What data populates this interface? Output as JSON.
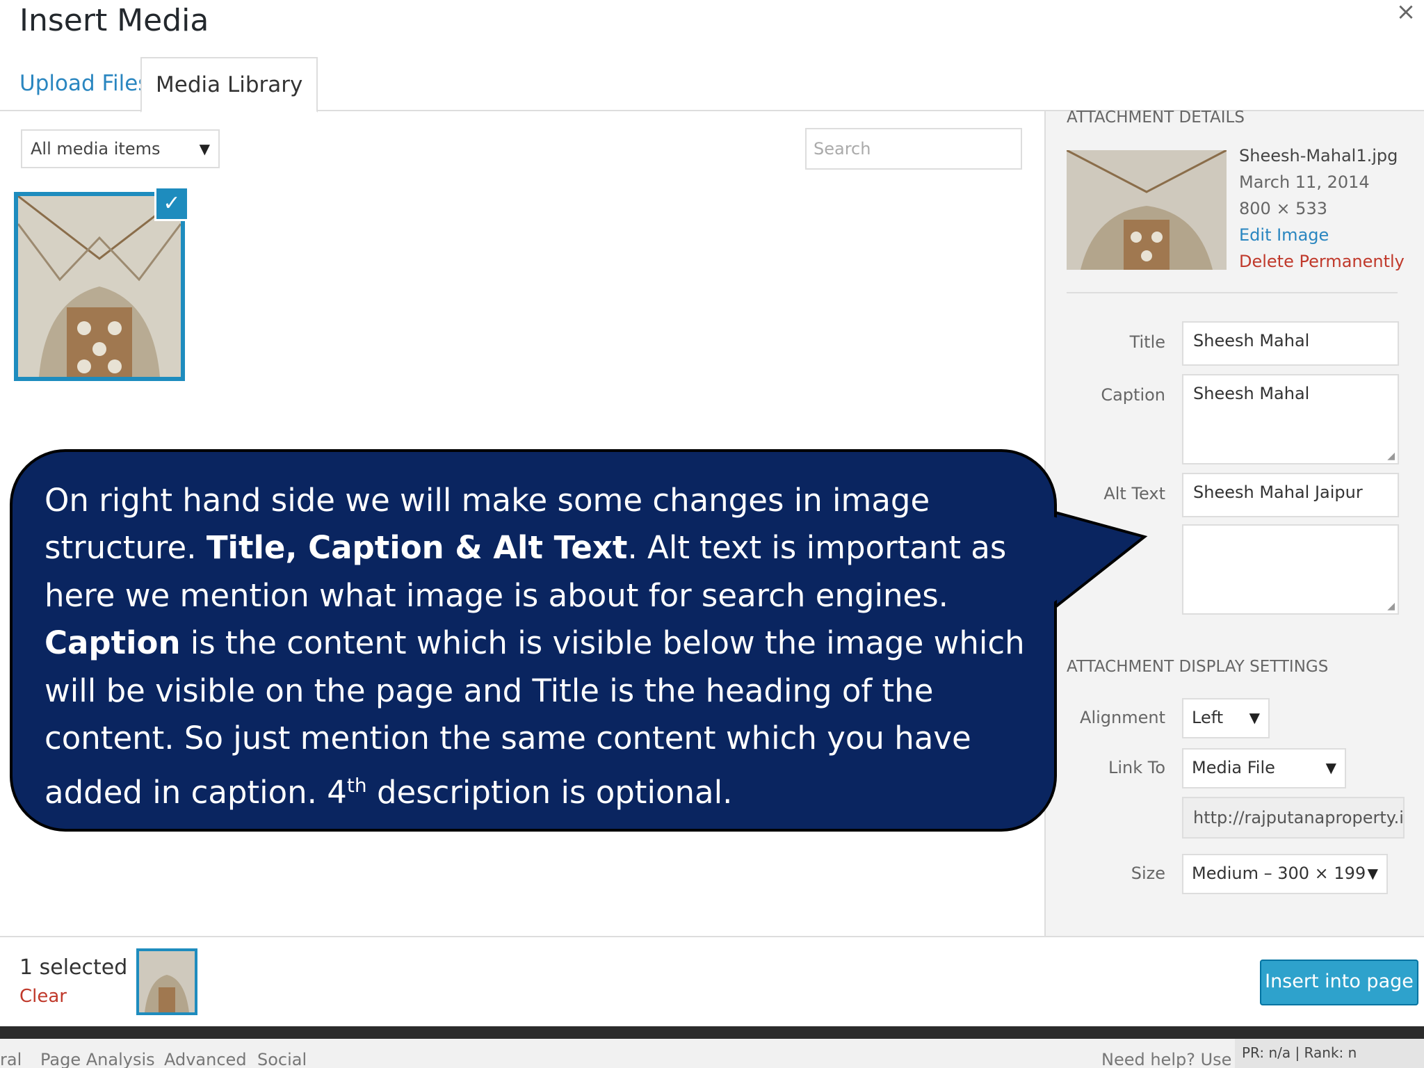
{
  "dialog": {
    "title": "Insert Media",
    "close_symbol": "×"
  },
  "tabs": [
    {
      "label": "Upload Files"
    },
    {
      "label": "Media Library"
    }
  ],
  "library": {
    "filter_value": "All media items",
    "search_placeholder": "Search"
  },
  "attachment": {
    "heading": "ATTACHMENT DETAILS",
    "filename": "Sheesh-Mahal1.jpg",
    "date": "March 11, 2014",
    "dimensions": "800 × 533",
    "edit_label": "Edit Image",
    "delete_label": "Delete Permanently"
  },
  "fields": {
    "title_label": "Title",
    "title_value": "Sheesh Mahal",
    "caption_label": "Caption",
    "caption_value": "Sheesh Mahal",
    "alt_label": "Alt Text",
    "alt_value": "Sheesh Mahal Jaipur",
    "description_value": ""
  },
  "display_settings": {
    "heading": "ATTACHMENT DISPLAY SETTINGS",
    "alignment_label": "Alignment",
    "alignment_value": "Left",
    "link_label": "Link To",
    "link_value": "Media File",
    "url_value": "http://rajputanaproperty.in",
    "size_label": "Size",
    "size_value": "Medium – 300 × 199"
  },
  "footer": {
    "selected_text": "1 selected",
    "clear_label": "Clear",
    "insert_label": "Insert into page"
  },
  "bottom_bar": {
    "tabs": [
      "ral",
      "Page Analysis",
      "Advanced",
      "Social"
    ],
    "help_text": "Need help? Use t",
    "rank_text": "PR: n/a | Rank: n"
  },
  "callout": {
    "segments": [
      "On right hand side we will make some changes in image structure. ",
      "Title, Caption & Alt Text",
      ". Alt text is important as here we mention what image is about for search engines. ",
      "Caption",
      " is the content which is visible below the image which will be visible on the page and Title is the heading of the content. So just mention the same content which you have added in caption. 4",
      "th",
      " description is optional."
    ]
  },
  "colors": {
    "accent": "#1e8cbe",
    "button": "#2ea2cc",
    "link": "#2a86c0",
    "danger": "#c0392b",
    "callout_bg": "#0a2560"
  }
}
